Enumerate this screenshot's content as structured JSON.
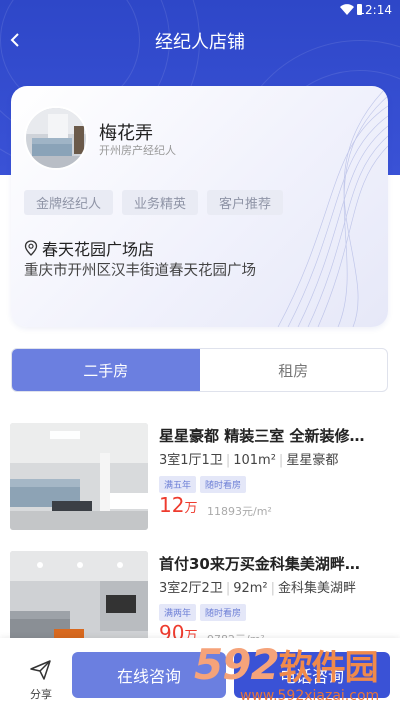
{
  "status_bar": {
    "time": "12:14"
  },
  "header": {
    "title": "经纪人店铺"
  },
  "agent": {
    "name": "梅花弄",
    "role": "开州房产经纪人",
    "tags": [
      "金牌经纪人",
      "业务精英",
      "客户推荐"
    ],
    "store_name": "春天花园广场店",
    "store_address": "重庆市开州区汉丰街道春天花园广场"
  },
  "tabs": [
    {
      "label": "二手房",
      "active": true
    },
    {
      "label": "租房",
      "active": false
    }
  ],
  "listings": [
    {
      "title": "星星豪都 精装三室 全新装修…",
      "layout": "3室1厅1卫",
      "area": "101m²",
      "community": "星星豪都",
      "badges": [
        "满五年",
        "随时看房"
      ],
      "price": "12",
      "price_unit": "万",
      "unit_price": "11893元/m²"
    },
    {
      "title": "首付30来万买金科集美湖畔…",
      "layout": "3室2厅2卫",
      "area": "92m²",
      "community": "金科集美湖畔",
      "badges": [
        "满两年",
        "随时看房"
      ],
      "price": "90",
      "price_unit": "万",
      "unit_price": "9782元/m²"
    }
  ],
  "bottom_bar": {
    "share_label": "分享",
    "consult_label": "在线咨询",
    "call_label": "电话咨询"
  },
  "watermark": {
    "logo_number": "592",
    "logo_text": "软件园",
    "url": "www.592xiazai.com"
  },
  "colors": {
    "primary": "#3a52d6",
    "accent": "#6b7fe0",
    "price": "#ee3b2e"
  }
}
